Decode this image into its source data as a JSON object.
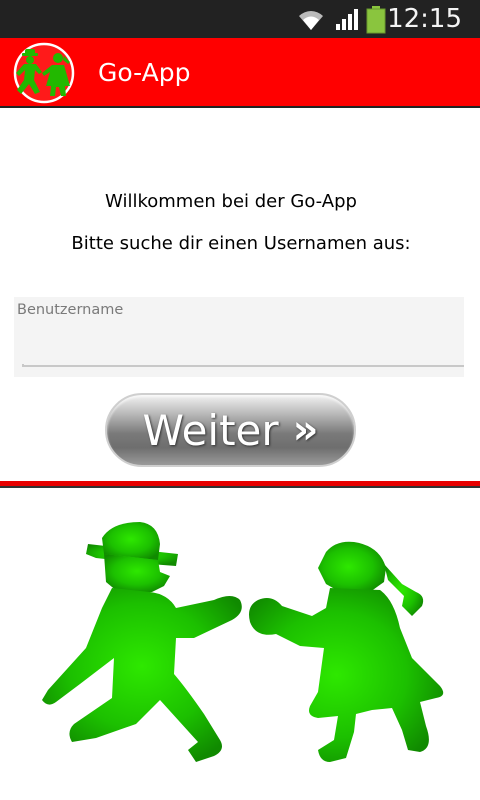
{
  "status_bar": {
    "time": "12:15",
    "icons": [
      "wifi-icon",
      "signal-icon",
      "battery-icon"
    ]
  },
  "action_bar": {
    "title": "Go-App",
    "logo": "ampelmann-logo-icon",
    "background_color": "#ff0000"
  },
  "main": {
    "welcome": "Willkommen bei der Go-App",
    "prompt": "Bitte suche dir einen Usernamen aus:",
    "username_field": {
      "label": "Benutzername",
      "value": ""
    },
    "next_button": {
      "label": "Weiter",
      "icon": "double-chevron-right-icon"
    }
  },
  "illustration": {
    "figures": [
      "ampelmann-icon",
      "ampelfrau-icon"
    ],
    "color": "#22cc00"
  }
}
